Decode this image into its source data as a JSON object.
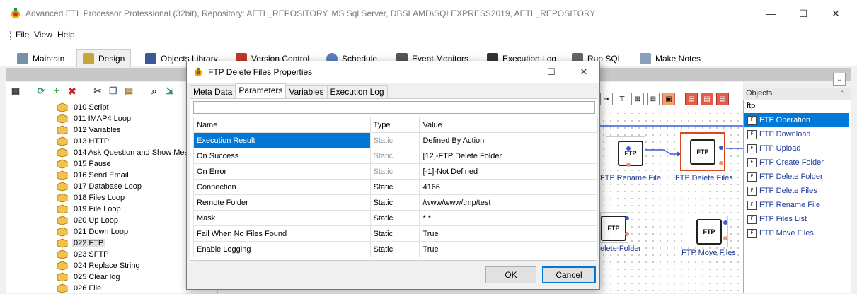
{
  "window": {
    "title": "Advanced ETL Processor Professional (32bit), Repository: AETL_REPOSITORY, MS Sql Server, DBSLAMD\\SQLEXPRESS2019, AETL_REPOSITORY",
    "minimize": "—",
    "maximize": "☐",
    "close": "✕"
  },
  "menu": [
    {
      "label": "File"
    },
    {
      "label": "View"
    },
    {
      "label": "Help"
    }
  ],
  "tabs": [
    {
      "label": "Maintain",
      "icon": "wrench-icon"
    },
    {
      "label": "Design",
      "icon": "design-icon",
      "active": true
    },
    {
      "label": "Objects Library",
      "icon": "library-icon"
    },
    {
      "label": "Version Control",
      "icon": "version-icon"
    },
    {
      "label": "Schedule",
      "icon": "clock-icon"
    },
    {
      "label": "Event Monitors",
      "icon": "monitor-icon"
    },
    {
      "label": "Execution Log",
      "icon": "log-icon"
    },
    {
      "label": "Run SQL",
      "icon": "sql-icon"
    },
    {
      "label": "Make Notes",
      "icon": "notes-icon"
    }
  ],
  "tree": {
    "items": [
      {
        "label": "010 Script"
      },
      {
        "label": "011 IMAP4 Loop"
      },
      {
        "label": "012 Variables"
      },
      {
        "label": "013 HTTP"
      },
      {
        "label": "014 Ask Question and Show Mes"
      },
      {
        "label": "015 Pause"
      },
      {
        "label": "016 Send Email"
      },
      {
        "label": "017 Database Loop"
      },
      {
        "label": "018 Files Loop"
      },
      {
        "label": "019 File Loop"
      },
      {
        "label": "020 Up Loop"
      },
      {
        "label": "021 Down Loop"
      },
      {
        "label": "022 FTP",
        "selected": true
      },
      {
        "label": "023 SFTP"
      },
      {
        "label": "024 Replace String"
      },
      {
        "label": "025 Clear log"
      },
      {
        "label": "026 File"
      }
    ]
  },
  "canvas": {
    "nodes": [
      {
        "label": "FTP Rename File"
      },
      {
        "label": "FTP Delete Files",
        "selected": true
      },
      {
        "label": "elete Folder"
      },
      {
        "label": "FTP Move Files"
      }
    ]
  },
  "objects": {
    "header": "Objects",
    "filter": "ftp",
    "items": [
      {
        "label": "FTP Operation",
        "selected": true
      },
      {
        "label": "FTP Download"
      },
      {
        "label": "FTP Upload"
      },
      {
        "label": "FTP Create Folder"
      },
      {
        "label": "FTP Delete Folder"
      },
      {
        "label": "FTP Delete Files"
      },
      {
        "label": "FTP Rename File"
      },
      {
        "label": "FTP Files List"
      },
      {
        "label": "FTP Move Files"
      }
    ]
  },
  "dialog": {
    "title": "FTP Delete Files Properties",
    "tabs": [
      "Meta Data",
      "Parameters",
      "Variables",
      "Execution Log"
    ],
    "active_tab": "Parameters",
    "columns": [
      "Name",
      "Type",
      "Value"
    ],
    "rows": [
      {
        "name": "Execution Result",
        "type": "Static",
        "value": "Defined By Action",
        "selected": true,
        "dim": true
      },
      {
        "name": "On Success",
        "type": "Static",
        "value": "[12]-FTP Delete Folder",
        "dim": true
      },
      {
        "name": "On Error",
        "type": "Static",
        "value": "[-1]-Not Defined",
        "dim": true
      },
      {
        "name": "Connection",
        "type": "Static",
        "value": "4166"
      },
      {
        "name": "Remote Folder",
        "type": "Static",
        "value": "/www/www/tmp/test"
      },
      {
        "name": "Mask",
        "type": "Static",
        "value": "*.*"
      },
      {
        "name": "Fail When No Files Found",
        "type": "Static",
        "value": "True"
      },
      {
        "name": "Enable Logging",
        "type": "Static",
        "value": "True"
      }
    ],
    "ok_label": "OK",
    "cancel_label": "Cancel"
  },
  "colors": {
    "accent": "#0078d7",
    "node_label": "#1f3c9b",
    "selected_node_border": "#d9481c"
  }
}
